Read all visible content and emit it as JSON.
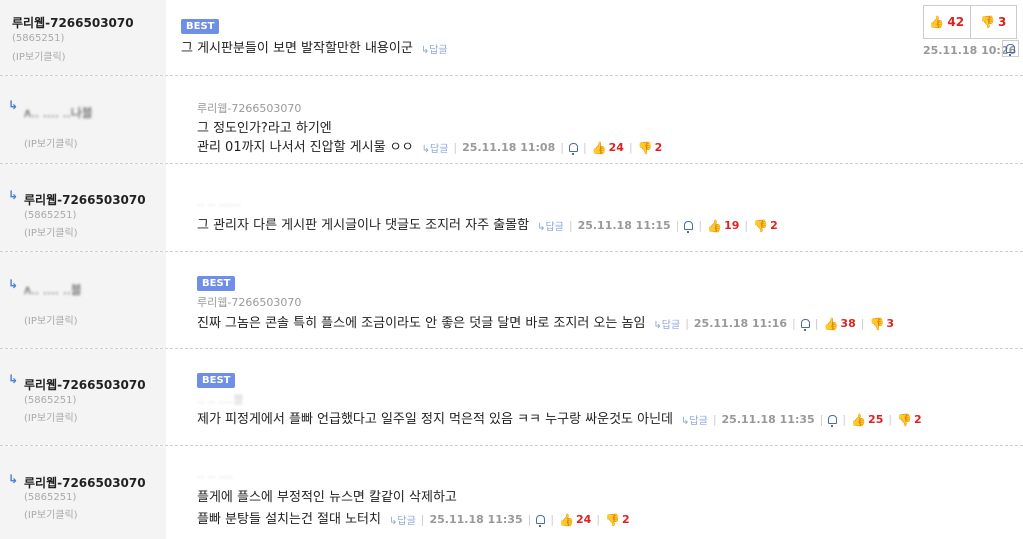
{
  "comments": [
    {
      "nick": "루리웹-7266503070",
      "uid": "(5865251)",
      "ip": "(IP보기클릭)",
      "best": "BEST",
      "text": "그 게시판분들이 보면 발작할만한 내용이군",
      "reply": "↳답글",
      "time": "25.11.18 10:26",
      "up": "42",
      "down": "3"
    },
    {
      "nick": "",
      "ip": "(IP보기클릭)",
      "parent": "루리웹-7266503070",
      "lines": [
        "그 정도인가?라고 하기엔",
        "관리 01까지 나서서 진압할 게시물 ㅇㅇ"
      ],
      "reply": "↳답글",
      "time": "25.11.18 11:08",
      "up": "24",
      "down": "2"
    },
    {
      "nick": "루리웹-7266503070",
      "uid": "(5865251)",
      "ip": "(IP보기클릭)",
      "parent": "",
      "text": "그 관리자 다른 게시판 게시글이나 댓글도 조지러 자주 출몰함",
      "reply": "↳답글",
      "time": "25.11.18 11:15",
      "up": "19",
      "down": "2"
    },
    {
      "nick": "",
      "ip": "(IP보기클릭)",
      "best": "BEST",
      "parent": "루리웹-7266503070",
      "text": "진짜 그놈은 콘솔 특히 플스에 조금이라도 안 좋은 덧글 달면 바로 조지러 오는 놈임",
      "reply": "↳답글",
      "time": "25.11.18 11:16",
      "up": "38",
      "down": "3"
    },
    {
      "nick": "루리웹-7266503070",
      "uid": "(5865251)",
      "ip": "(IP보기클릭)",
      "best": "BEST",
      "parent": "",
      "text": "제가 피정게에서 플빠 언급했다고 일주일 정지 먹은적 있음 ㅋㅋ 누구랑 싸운것도 아닌데",
      "reply": "↳답글",
      "time": "25.11.18 11:35",
      "up": "25",
      "down": "2"
    },
    {
      "nick": "루리웹-7266503070",
      "uid": "(5865251)",
      "ip": "(IP보기클릭)",
      "parent": "",
      "lines": [
        "플게에 플스에 부정적인 뉴스면 칼같이 삭제하고",
        "플빠 분탕들 설치는건 절대 노터치"
      ],
      "reply": "↳답글",
      "time": "25.11.18 11:35",
      "up": "24",
      "down": "2"
    }
  ]
}
